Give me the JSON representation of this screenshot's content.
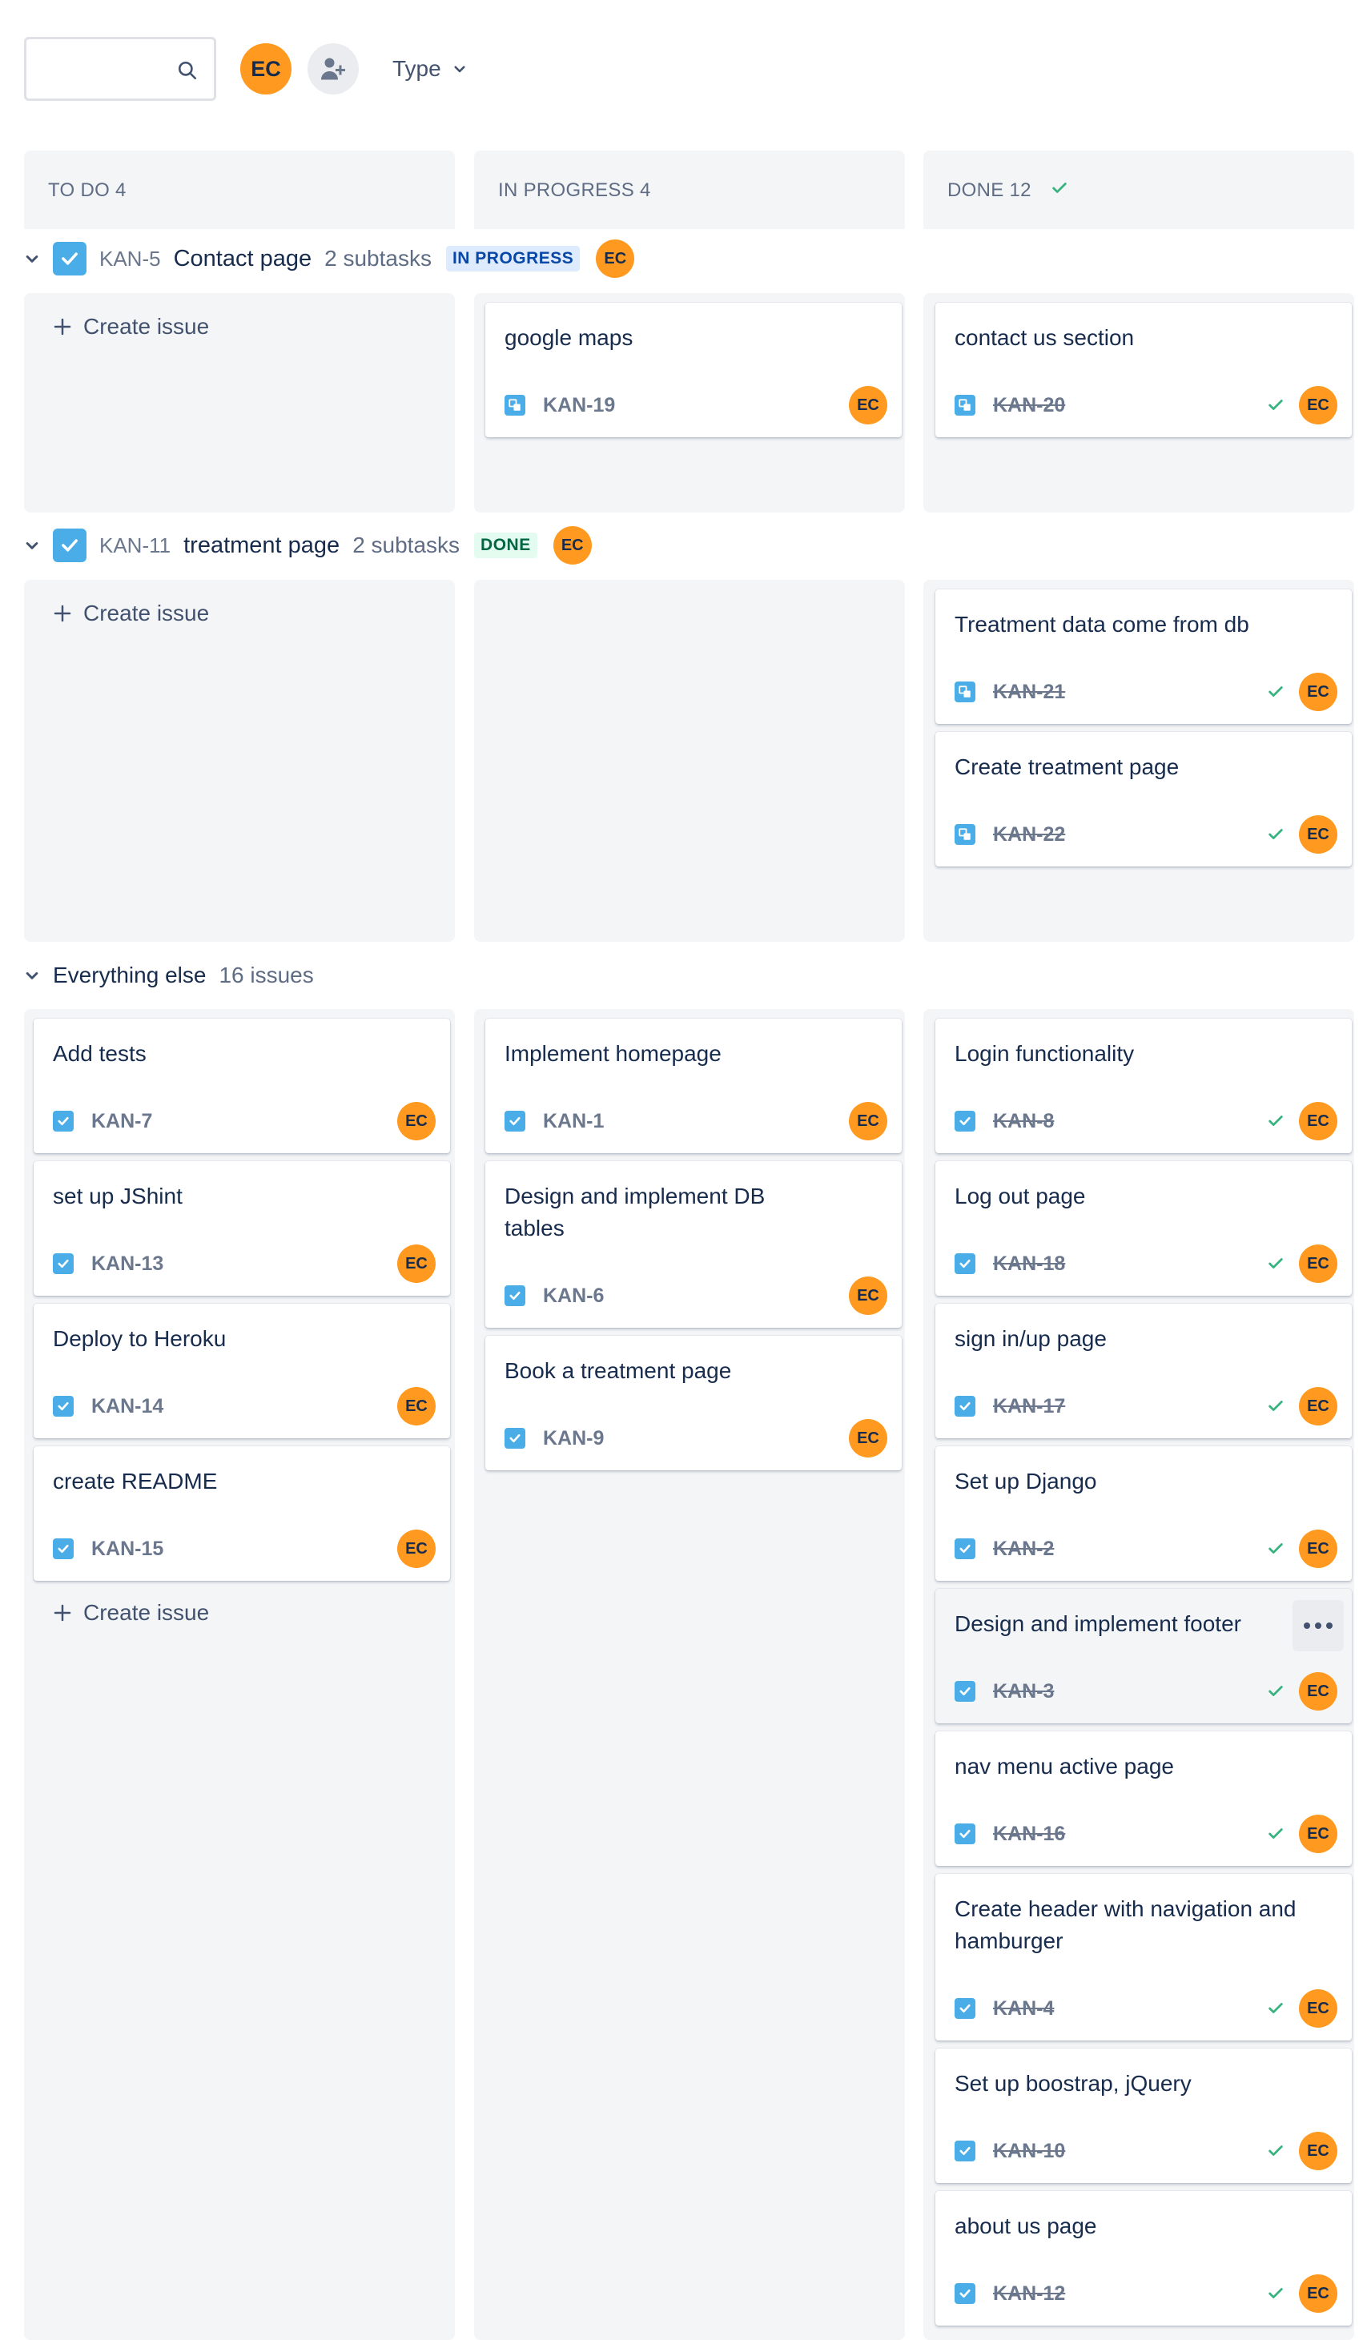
{
  "toolbar": {
    "search_placeholder": "",
    "user_initials": "EC",
    "type_filter_label": "Type"
  },
  "columns": [
    {
      "title": "TO DO 4"
    },
    {
      "title": "IN PROGRESS 4"
    },
    {
      "title": "DONE 12"
    }
  ],
  "lanes": {
    "contact": {
      "key": "KAN-5",
      "title": "Contact page",
      "subtasks": "2 subtasks",
      "status": "IN PROGRESS",
      "assignee": "EC"
    },
    "treatment": {
      "key": "KAN-11",
      "title": "treatment page",
      "subtasks": "2 subtasks",
      "status": "DONE",
      "assignee": "EC"
    },
    "else": {
      "title": "Everything else",
      "count": "16 issues"
    }
  },
  "create_issue_label": "Create issue",
  "cards": {
    "kan19": {
      "title": "google maps",
      "key": "KAN-19",
      "assignee": "EC"
    },
    "kan20": {
      "title": "contact us section",
      "key": "KAN-20",
      "assignee": "EC"
    },
    "kan21": {
      "title": "Treatment data come from db",
      "key": "KAN-21",
      "assignee": "EC"
    },
    "kan22": {
      "title": "Create treatment page",
      "key": "KAN-22",
      "assignee": "EC"
    },
    "kan7": {
      "title": "Add tests",
      "key": "KAN-7",
      "assignee": "EC"
    },
    "kan13": {
      "title": "set up JShint",
      "key": "KAN-13",
      "assignee": "EC"
    },
    "kan14": {
      "title": "Deploy to Heroku",
      "key": "KAN-14",
      "assignee": "EC"
    },
    "kan15": {
      "title": "create README",
      "key": "KAN-15",
      "assignee": "EC"
    },
    "kan1": {
      "title": "Implement homepage",
      "key": "KAN-1",
      "assignee": "EC"
    },
    "kan6": {
      "title": "Design and implement DB tables",
      "key": "KAN-6",
      "assignee": "EC"
    },
    "kan9": {
      "title": "Book a treatment page",
      "key": "KAN-9",
      "assignee": "EC"
    },
    "kan8": {
      "title": "Login functionality",
      "key": "KAN-8",
      "assignee": "EC"
    },
    "kan18": {
      "title": "Log out page",
      "key": "KAN-18",
      "assignee": "EC"
    },
    "kan17": {
      "title": "sign in/up page",
      "key": "KAN-17",
      "assignee": "EC"
    },
    "kan2": {
      "title": "Set up Django",
      "key": "KAN-2",
      "assignee": "EC"
    },
    "kan3": {
      "title": "Design and implement footer",
      "key": "KAN-3",
      "assignee": "EC"
    },
    "kan16": {
      "title": "nav menu active page",
      "key": "KAN-16",
      "assignee": "EC"
    },
    "kan4": {
      "title": "Create header with navigation and hamburger",
      "key": "KAN-4",
      "assignee": "EC"
    },
    "kan10": {
      "title": "Set up boostrap, jQuery",
      "key": "KAN-10",
      "assignee": "EC"
    },
    "kan12": {
      "title": "about us page",
      "key": "KAN-12",
      "assignee": "EC"
    }
  },
  "colors": {
    "avatar": "#ff991f",
    "task_icon": "#4bade8",
    "done_check": "#36b37e",
    "column_bg": "#f4f5f7"
  }
}
